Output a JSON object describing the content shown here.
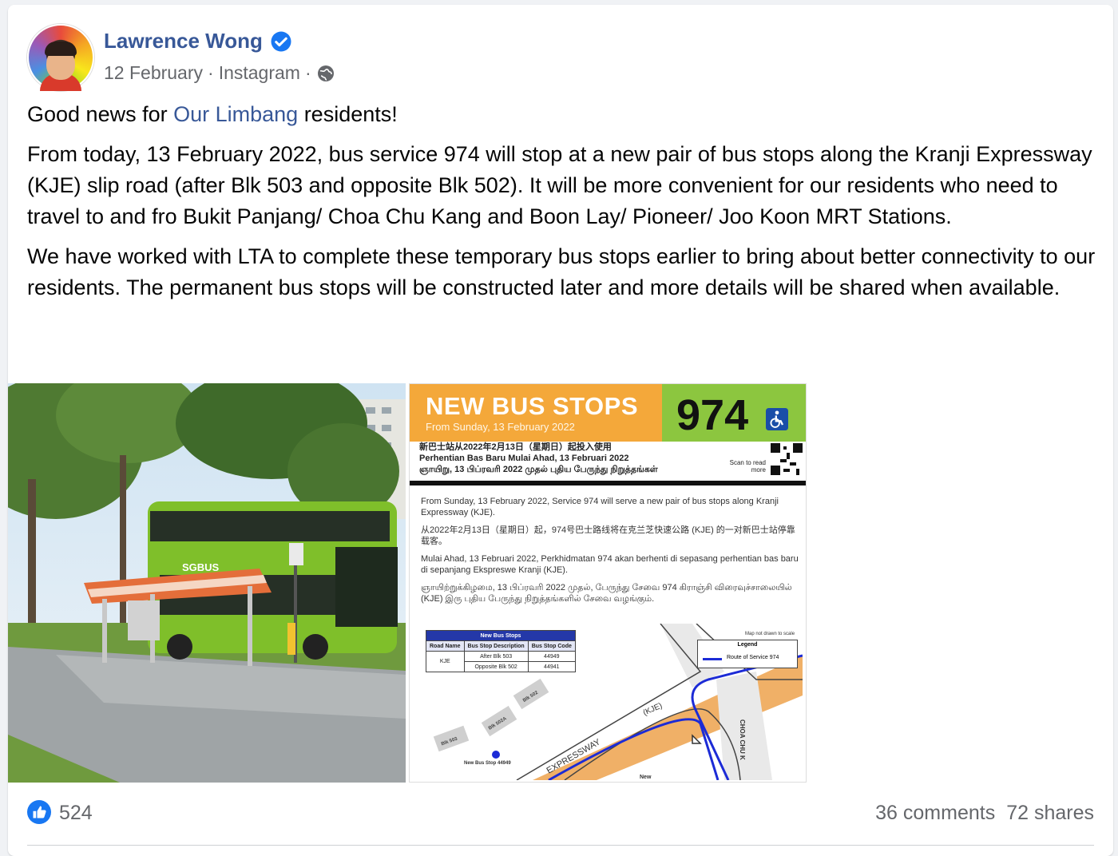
{
  "post": {
    "author": "Lawrence Wong",
    "date": "12 February",
    "source": "Instagram",
    "separator": "·",
    "paragraphs": {
      "p1_before": "Good news for ",
      "p1_link": "Our Limbang",
      "p1_after": " residents!",
      "p2": "From today, 13 February 2022, bus service 974 will stop at a new pair of bus stops along the Kranji Expressway (KJE) slip road (after Blk 503 and opposite Blk 502). It will be more convenient for our residents who need to travel to and fro Bukit Panjang/ Choa Chu Kang and Boon Lay/ Pioneer/ Joo Koon MRT Stations.",
      "p3": "We have worked with LTA to complete these temporary bus stops earlier to bring about better connectivity to our residents. The permanent bus stops will be constructed later and more details will be shared when available."
    }
  },
  "notice": {
    "title": "NEW BUS STOPS",
    "subtitle": "From Sunday, 13 February 2022",
    "service": "974",
    "lines": [
      "新巴士站从2022年2月13日（星期日）起投入使用",
      "Perhentian Bas Baru Mulai Ahad, 13 Februari 2022",
      "ஞாயிறு, 13 பிப்ரவரி 2022 முதல் புதிய பேருந்து நிறுத்தங்கள்"
    ],
    "scan": "Scan to read more",
    "body": [
      "From Sunday, 13 February 2022, Service 974 will serve a new pair of bus stops along Kranji Expressway (KJE).",
      "从2022年2月13日（星期日）起，974号巴士路线将在克兰芝快速公路 (KJE) 的一对新巴士站停靠载客。",
      "Mulai Ahad, 13 Februari 2022, Perkhidmatan 974 akan berhenti di sepasang perhentian bas baru di sepanjang Ekspreswe Kranji (KJE).",
      "ஞாயிற்றுக்கிழமை, 13 பிப்ரவரி 2022 முதல், பேருந்து சேவை 974 கிராஞ்சி விரைவுச்சாலையில் (KJE) இரு புதிய பேருந்து நிறுத்தங்களில் சேவை வழங்கும்."
    ],
    "table": {
      "caption": "New Bus Stops",
      "headers": [
        "Road Name",
        "Bus Stop Description",
        "Bus Stop Code"
      ],
      "road": "KJE",
      "rows": [
        {
          "desc": "After Blk 503",
          "code": "44949"
        },
        {
          "desc": "Opposite Blk 502",
          "code": "44941"
        }
      ]
    },
    "map": {
      "not_to_scale": "Map not drawn to scale",
      "legend_title": "Legend",
      "legend_item": "Route of Service 974",
      "kje": "(KJE)",
      "expressway": "EXPRESSWAY",
      "choa": "CHOA CHU K",
      "blk502": "Blk 502",
      "blk502a": "Blk 502A",
      "blk503": "Blk 503",
      "new_stop": "New Bus Stop 44949",
      "new": "New"
    }
  },
  "bus": {
    "brand": "SGBUS"
  },
  "engagement": {
    "likes": "524",
    "comments": "36 comments",
    "shares": "72 shares"
  },
  "colors": {
    "link": "#385898",
    "meta": "#65676b",
    "like_blue": "#1877f2",
    "notice_orange": "#f4a83a",
    "notice_green": "#8cc63f"
  }
}
